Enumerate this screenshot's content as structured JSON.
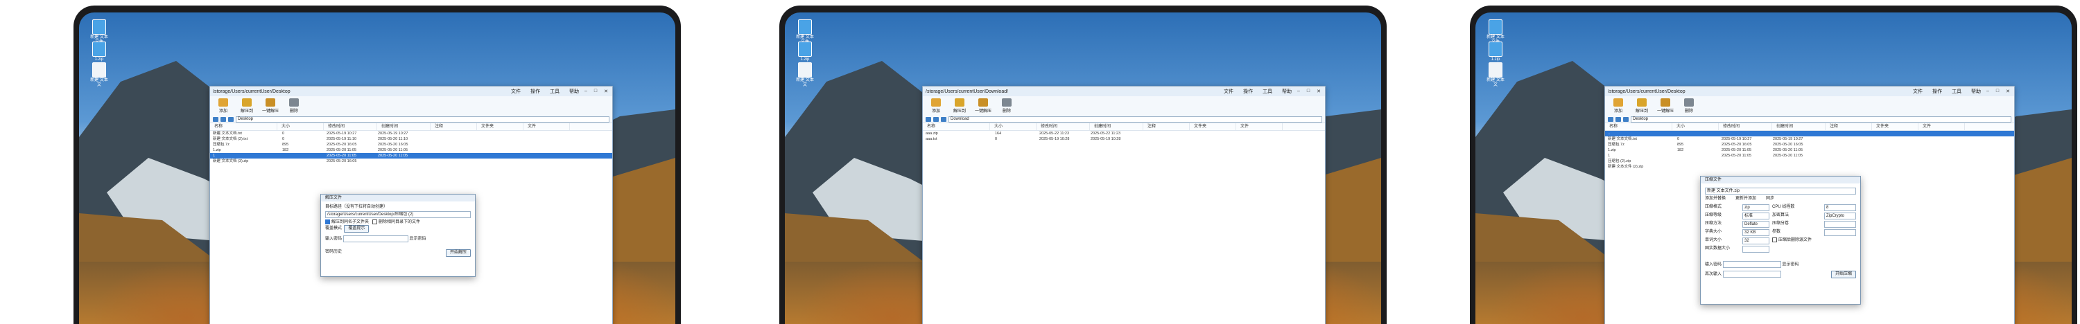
{
  "desktop_icons": [
    {
      "label": "新建 文本文件"
    },
    {
      "label": "1.zip"
    },
    {
      "label": "新建 文本文"
    }
  ],
  "menu": [
    "文件",
    "操作",
    "工具",
    "帮助"
  ],
  "toolbar": [
    "添加",
    "解压到",
    "一键解压",
    "删除"
  ],
  "panel1": {
    "path": "/storage/Users/currentUser/Desktop",
    "address": "Desktop",
    "columns": [
      "名称",
      "大小",
      "修改时间",
      "创建时间",
      "注释",
      "文件夹",
      "文件"
    ],
    "rows": [
      {
        "name": "新建 文本文档.txt",
        "size": "0",
        "modified": "2025-05-19 10:27",
        "created": "2025-05-19 10:27"
      },
      {
        "name": "新建 文本文档 (2).txt",
        "size": "0",
        "modified": "2025-05-19 11:10",
        "created": "2025-05-20 11:10"
      },
      {
        "name": "压缩包.7z",
        "size": "895",
        "modified": "2025-05-20 16:05",
        "created": "2025-05-20 16:05"
      },
      {
        "name": "1.zip",
        "size": "182",
        "modified": "2025-05-20 11:05",
        "created": "2025-05-20 11:05"
      },
      {
        "name": "1",
        "size": "",
        "modified": "2025-05-20 11:05",
        "created": "2025-05-20 11:05"
      },
      {
        "name": "新建 文本文档 (3).zip",
        "size": "",
        "modified": "2025-05-20 16:05",
        "created": ""
      }
    ],
    "dialog": {
      "title": "解压文件",
      "target_label": "目标路径（没有下拉将自动创建）",
      "target_value": "/storage/Users/currentUser/Desktop/压缩包 (2)",
      "opt1": "解压到同名子文件夹",
      "opt2": "删除相同目录下的文件",
      "overwrite_label": "覆盖模式",
      "overwrite_value": "覆盖提示",
      "password_label": "输入密码",
      "show_password": "显示密码",
      "history_label": "密码历史",
      "ok": "开始解压"
    }
  },
  "panel2": {
    "path": "/storage/Users/currentUser/Download/",
    "address": "Download",
    "columns": [
      "名称",
      "大小",
      "修改时间",
      "创建时间",
      "注释",
      "文件夹",
      "文件"
    ],
    "rows": [
      {
        "name": "aaa.zip",
        "size": "164",
        "modified": "2025-05-22 11:23",
        "created": "2025-05-22 11:23"
      },
      {
        "name": "aaa.txt",
        "size": "0",
        "modified": "2025-05-19 10:28",
        "created": "2025-05-19 10:28"
      }
    ]
  },
  "panel3": {
    "path": "/storage/Users/currentUser/Desktop",
    "address": "Desktop",
    "columns": [
      "名称",
      "大小",
      "修改时间",
      "创建时间",
      "注释",
      "文件夹",
      "文件"
    ],
    "rows": [
      {
        "name": "..",
        "size": "",
        "modified": "",
        "created": ""
      },
      {
        "name": "新建 文本文档.txt",
        "size": "0",
        "modified": "2025-05-19 10:27",
        "created": "2025-05-19 10:27"
      },
      {
        "name": "压缩包.7z",
        "size": "895",
        "modified": "2025-05-20 16:05",
        "created": "2025-05-20 16:05"
      },
      {
        "name": "1.zip",
        "size": "182",
        "modified": "2025-05-20 11:05",
        "created": "2025-05-20 11:05"
      },
      {
        "name": "1",
        "size": "",
        "modified": "2025-05-20 11:05",
        "created": "2025-05-20 11:05"
      },
      {
        "name": "压缩包 (2).zip",
        "size": "",
        "modified": "",
        "created": ""
      },
      {
        "name": "新建 文本文件 (2).zip",
        "size": "",
        "modified": "",
        "created": ""
      }
    ],
    "dialog": {
      "title": "压缩文件",
      "target_value": "新建 文本文件.zip",
      "mode_labels": [
        "添加并替换",
        "更新并添加",
        "同步"
      ],
      "format_label": "压缩格式",
      "format_value": "zip",
      "level_label": "压缩等级",
      "level_value": "标准",
      "method_label": "压缩方法",
      "method_value": "Deflate",
      "dict_label": "字典大小",
      "dict_value": "32 KB",
      "word_label": "单词大小",
      "word_value": "32",
      "solid_label": "固实数据大小",
      "solid_value": "",
      "cpu_label": "CPU 线程数",
      "cpu_value": "8",
      "encrypt_label": "加密算法",
      "encrypt_value": "ZipCrypto",
      "volume_label": "压缩分卷",
      "volume_value": "",
      "sfx_label": "参数",
      "delete_after": "压缩后删除源文件",
      "password_label": "输入密码",
      "show_password": "显示密码",
      "confirm_label": "再次输入",
      "ok": "开始压缩"
    }
  }
}
